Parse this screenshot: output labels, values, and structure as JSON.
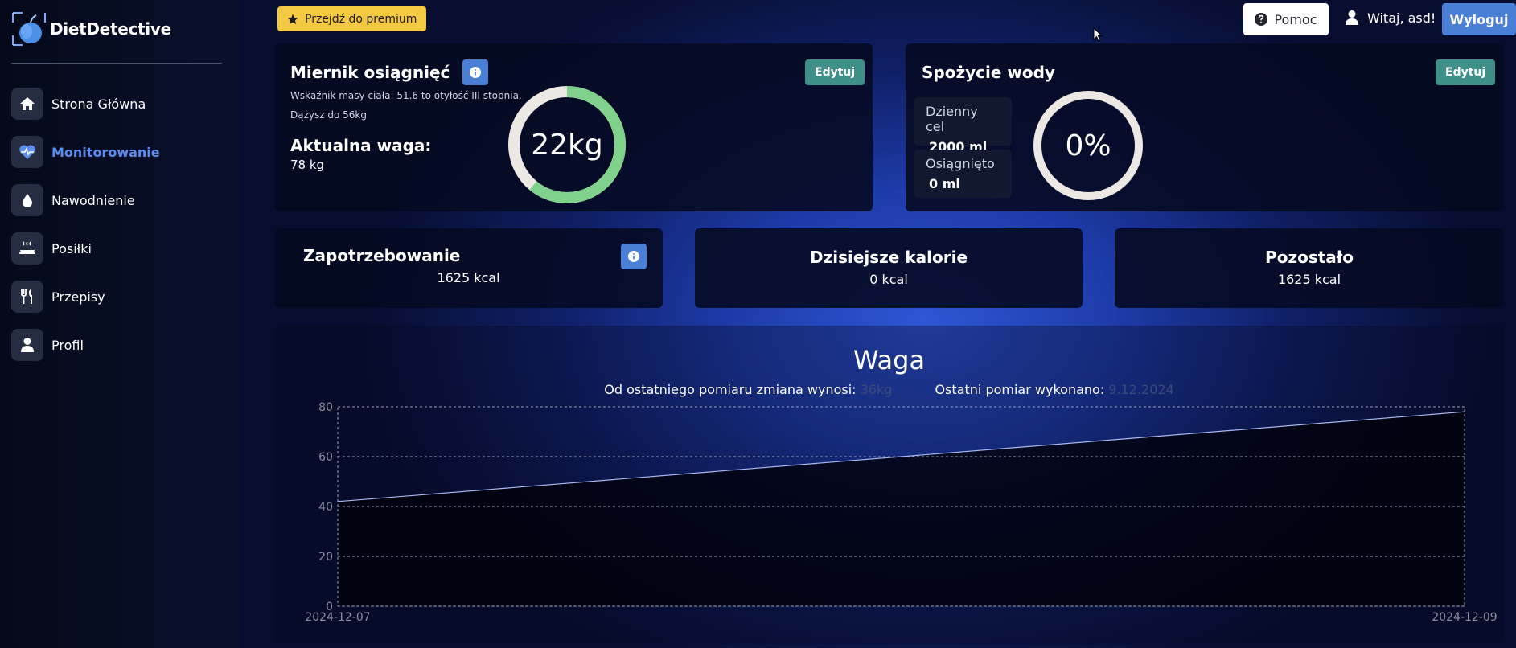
{
  "app": {
    "name": "DietDetective"
  },
  "sidebar": {
    "items": [
      {
        "label": "Strona Główna",
        "icon": "home-icon",
        "active": false
      },
      {
        "label": "Monitorowanie",
        "icon": "heart-pulse-icon",
        "active": true
      },
      {
        "label": "Nawodnienie",
        "icon": "droplet-icon",
        "active": false
      },
      {
        "label": "Posiłki",
        "icon": "meal-icon",
        "active": false
      },
      {
        "label": "Przepisy",
        "icon": "utensils-icon",
        "active": false
      },
      {
        "label": "Profil",
        "icon": "user-icon",
        "active": false
      }
    ]
  },
  "header": {
    "premium_label": "Przejdź do premium",
    "help_label": "Pomoc",
    "greeting": "Witaj, asd!",
    "logout_label": "Wyloguj"
  },
  "achievement": {
    "title": "Miernik osiągnięć",
    "edit_label": "Edytuj",
    "bmi_text": "Wskaźnik masy ciała: 51.6 to otyłość III stopnia.",
    "goal_text": "Dążysz do 56kg",
    "weight_heading": "Aktualna waga:",
    "weight_value": "78 kg",
    "gauge_label": "22kg",
    "gauge_progress": 0.61
  },
  "water": {
    "title": "Spożycie wody",
    "edit_label": "Edytuj",
    "daily_goal_label": "Dzienny cel",
    "daily_goal_value": "2000 ml",
    "achieved_label": "Osiągnięto",
    "achieved_value": "0 ml",
    "gauge_label": "0%",
    "gauge_progress": 0
  },
  "stats": {
    "demand_title": "Zapotrzebowanie",
    "demand_value": "1625 kcal",
    "today_title": "Dzisiejsze kalorie",
    "today_value": "0 kcal",
    "left_title": "Pozostało",
    "left_value": "1625 kcal"
  },
  "weight_chart": {
    "title": "Waga",
    "change_label": "Od ostatniego pomiaru zmiana wynosi:",
    "change_value": "36kg",
    "last_label": "Ostatni pomiar wykonano:",
    "last_value": "9.12.2024"
  },
  "colors": {
    "accent": "#4a7fd6",
    "active_nav": "#5b8def",
    "progress_green": "#7fd18b",
    "ring_track": "#ece8e3",
    "edit_button": "#3f9089",
    "premium": "#f5c842"
  },
  "chart_data": {
    "type": "line",
    "x": [
      "2024-12-07",
      "2024-12-09"
    ],
    "series": [
      {
        "values": [
          42,
          78
        ]
      }
    ],
    "ylim": [
      0,
      80
    ],
    "yticks": [
      0,
      20,
      40,
      60,
      80
    ],
    "grid": true
  }
}
